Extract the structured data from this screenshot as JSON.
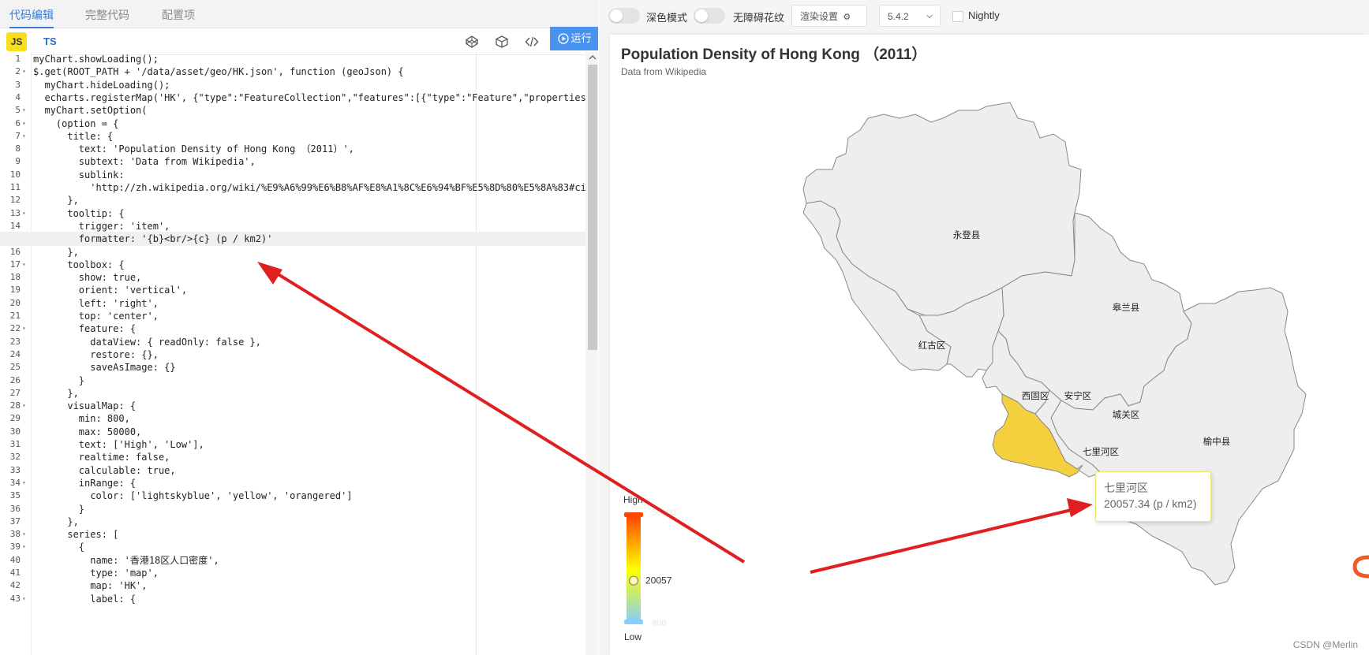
{
  "editor": {
    "tabs": [
      {
        "label": "代码编辑",
        "active": true
      },
      {
        "label": "完整代码",
        "active": false
      },
      {
        "label": "配置项",
        "active": false
      }
    ],
    "lang_js": "JS",
    "lang_ts": "TS",
    "run_label": "运行",
    "code_lines": [
      "myChart.showLoading();",
      "$.get(ROOT_PATH + '/data/asset/geo/HK.json', function (geoJson) {",
      "  myChart.hideLoading();",
      "  echarts.registerMap('HK', {\"type\":\"FeatureCollection\",\"features\":[{\"type\":\"Feature\",\"properties\":{",
      "  myChart.setOption(",
      "    (option = {",
      "      title: {",
      "        text: 'Population Density of Hong Kong （2011）',",
      "        subtext: 'Data from Wikipedia',",
      "        sublink:",
      "          'http://zh.wikipedia.org/wiki/%E9%A6%99%E6%B8%AF%E8%A1%8C%E6%94%BF%E5%8D%80%E5%8A%83#cite_",
      "      },",
      "      tooltip: {",
      "        trigger: 'item',",
      "        formatter: '{b}<br/>{c} (p / km2)'",
      "      },",
      "      toolbox: {",
      "        show: true,",
      "        orient: 'vertical',",
      "        left: 'right',",
      "        top: 'center',",
      "        feature: {",
      "          dataView: { readOnly: false },",
      "          restore: {},",
      "          saveAsImage: {}",
      "        }",
      "      },",
      "      visualMap: {",
      "        min: 800,",
      "        max: 50000,",
      "        text: ['High', 'Low'],",
      "        realtime: false,",
      "        calculable: true,",
      "        inRange: {",
      "          color: ['lightskyblue', 'yellow', 'orangered']",
      "        }",
      "      },",
      "      series: [",
      "        {",
      "          name: '香港18区人口密度',",
      "          type: 'map',",
      "          map: 'HK',",
      "          label: {"
    ],
    "fold_lines": [
      2,
      5,
      6,
      7,
      13,
      17,
      22,
      28,
      34,
      38,
      39,
      43
    ],
    "highlight_line": 15
  },
  "preview": {
    "dark_mode_label": "深色模式",
    "accessible_label": "无障碍花纹",
    "render_settings_label": "渲染设置",
    "version_label": "5.4.2",
    "nightly_label": "Nightly",
    "chart_title": "Population Density of Hong Kong （2011）",
    "chart_subtitle": "Data from Wikipedia",
    "districts": [
      {
        "name": "永登县",
        "selected": false
      },
      {
        "name": "皋兰县",
        "selected": false
      },
      {
        "name": "红古区",
        "selected": false
      },
      {
        "name": "西固区",
        "selected": false
      },
      {
        "name": "安宁区",
        "selected": false
      },
      {
        "name": "城关区",
        "selected": false
      },
      {
        "name": "七里河区",
        "selected": true
      },
      {
        "name": "榆中县",
        "selected": false
      }
    ],
    "visual_map": {
      "high_label": "High",
      "low_label": "Low",
      "max_label": "50000",
      "min_label": "800",
      "current_value_label": "20057",
      "current_level": 0.392,
      "colors": [
        "#87cefa",
        "#ffff00",
        "#ff4500"
      ]
    },
    "tooltip": {
      "name": "七里河区",
      "value": "20057.34 (p / km2)"
    },
    "colors": {
      "selected_fill": "#f4d03f",
      "region_fill": "#eeeeee",
      "region_stroke": "#888888",
      "accent": "#4893f0",
      "arrow": "#e02020"
    }
  },
  "watermark": "CSDN @Merlin"
}
